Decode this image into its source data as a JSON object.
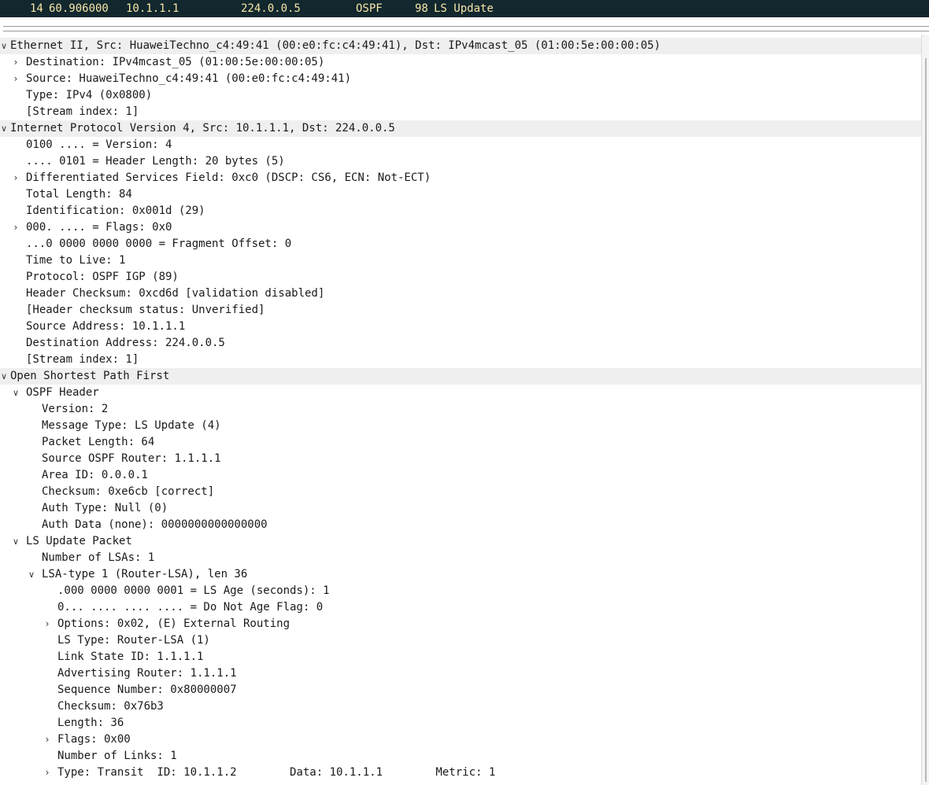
{
  "packet_list": {
    "selected_row": {
      "number": "14",
      "time": "60.906000",
      "source": "10.1.1.1",
      "destination": "224.0.0.5",
      "protocol": "OSPF",
      "length": "98",
      "info": "LS Update"
    }
  },
  "details": [
    {
      "level": 0,
      "toggle": "expanded",
      "section": true,
      "text": "Ethernet II, Src: HuaweiTechno_c4:49:41 (00:e0:fc:c4:49:41), Dst: IPv4mcast_05 (01:00:5e:00:00:05)"
    },
    {
      "level": 1,
      "toggle": "collapsed",
      "text": "Destination: IPv4mcast_05 (01:00:5e:00:00:05)"
    },
    {
      "level": 1,
      "toggle": "collapsed",
      "text": "Source: HuaweiTechno_c4:49:41 (00:e0:fc:c4:49:41)"
    },
    {
      "level": 1,
      "toggle": "none",
      "text": "Type: IPv4 (0x0800)"
    },
    {
      "level": 1,
      "toggle": "none",
      "text": "[Stream index: 1]"
    },
    {
      "level": 0,
      "toggle": "expanded",
      "section": true,
      "text": "Internet Protocol Version 4, Src: 10.1.1.1, Dst: 224.0.0.5"
    },
    {
      "level": 1,
      "toggle": "none",
      "text": "0100 .... = Version: 4"
    },
    {
      "level": 1,
      "toggle": "none",
      "text": ".... 0101 = Header Length: 20 bytes (5)"
    },
    {
      "level": 1,
      "toggle": "collapsed",
      "text": "Differentiated Services Field: 0xc0 (DSCP: CS6, ECN: Not-ECT)"
    },
    {
      "level": 1,
      "toggle": "none",
      "text": "Total Length: 84"
    },
    {
      "level": 1,
      "toggle": "none",
      "text": "Identification: 0x001d (29)"
    },
    {
      "level": 1,
      "toggle": "collapsed",
      "text": "000. .... = Flags: 0x0"
    },
    {
      "level": 1,
      "toggle": "none",
      "text": "...0 0000 0000 0000 = Fragment Offset: 0"
    },
    {
      "level": 1,
      "toggle": "none",
      "text": "Time to Live: 1"
    },
    {
      "level": 1,
      "toggle": "none",
      "text": "Protocol: OSPF IGP (89)"
    },
    {
      "level": 1,
      "toggle": "none",
      "text": "Header Checksum: 0xcd6d [validation disabled]"
    },
    {
      "level": 1,
      "toggle": "none",
      "text": "[Header checksum status: Unverified]"
    },
    {
      "level": 1,
      "toggle": "none",
      "text": "Source Address: 10.1.1.1"
    },
    {
      "level": 1,
      "toggle": "none",
      "text": "Destination Address: 224.0.0.5"
    },
    {
      "level": 1,
      "toggle": "none",
      "text": "[Stream index: 1]"
    },
    {
      "level": 0,
      "toggle": "expanded",
      "section": true,
      "text": "Open Shortest Path First"
    },
    {
      "level": 1,
      "toggle": "expanded",
      "text": "OSPF Header"
    },
    {
      "level": 2,
      "toggle": "none",
      "text": "Version: 2"
    },
    {
      "level": 2,
      "toggle": "none",
      "text": "Message Type: LS Update (4)"
    },
    {
      "level": 2,
      "toggle": "none",
      "text": "Packet Length: 64"
    },
    {
      "level": 2,
      "toggle": "none",
      "text": "Source OSPF Router: 1.1.1.1"
    },
    {
      "level": 2,
      "toggle": "none",
      "text": "Area ID: 0.0.0.1"
    },
    {
      "level": 2,
      "toggle": "none",
      "text": "Checksum: 0xe6cb [correct]"
    },
    {
      "level": 2,
      "toggle": "none",
      "text": "Auth Type: Null (0)"
    },
    {
      "level": 2,
      "toggle": "none",
      "text": "Auth Data (none): 0000000000000000"
    },
    {
      "level": 1,
      "toggle": "expanded",
      "text": "LS Update Packet"
    },
    {
      "level": 2,
      "toggle": "none",
      "text": "Number of LSAs: 1"
    },
    {
      "level": 2,
      "toggle": "expanded",
      "text": "LSA-type 1 (Router-LSA), len 36"
    },
    {
      "level": 3,
      "toggle": "none",
      "text": ".000 0000 0000 0001 = LS Age (seconds): 1"
    },
    {
      "level": 3,
      "toggle": "none",
      "text": "0... .... .... .... = Do Not Age Flag: 0"
    },
    {
      "level": 3,
      "toggle": "collapsed",
      "text": "Options: 0x02, (E) External Routing"
    },
    {
      "level": 3,
      "toggle": "none",
      "text": "LS Type: Router-LSA (1)"
    },
    {
      "level": 3,
      "toggle": "none",
      "text": "Link State ID: 1.1.1.1"
    },
    {
      "level": 3,
      "toggle": "none",
      "text": "Advertising Router: 1.1.1.1"
    },
    {
      "level": 3,
      "toggle": "none",
      "text": "Sequence Number: 0x80000007"
    },
    {
      "level": 3,
      "toggle": "none",
      "text": "Checksum: 0x76b3"
    },
    {
      "level": 3,
      "toggle": "none",
      "text": "Length: 36"
    },
    {
      "level": 3,
      "toggle": "collapsed",
      "text": "Flags: 0x00"
    },
    {
      "level": 3,
      "toggle": "none",
      "text": "Number of Links: 1"
    },
    {
      "level": 3,
      "toggle": "collapsed",
      "text": "Type: Transit  ID: 10.1.1.2        Data: 10.1.1.1        Metric: 1"
    }
  ]
}
